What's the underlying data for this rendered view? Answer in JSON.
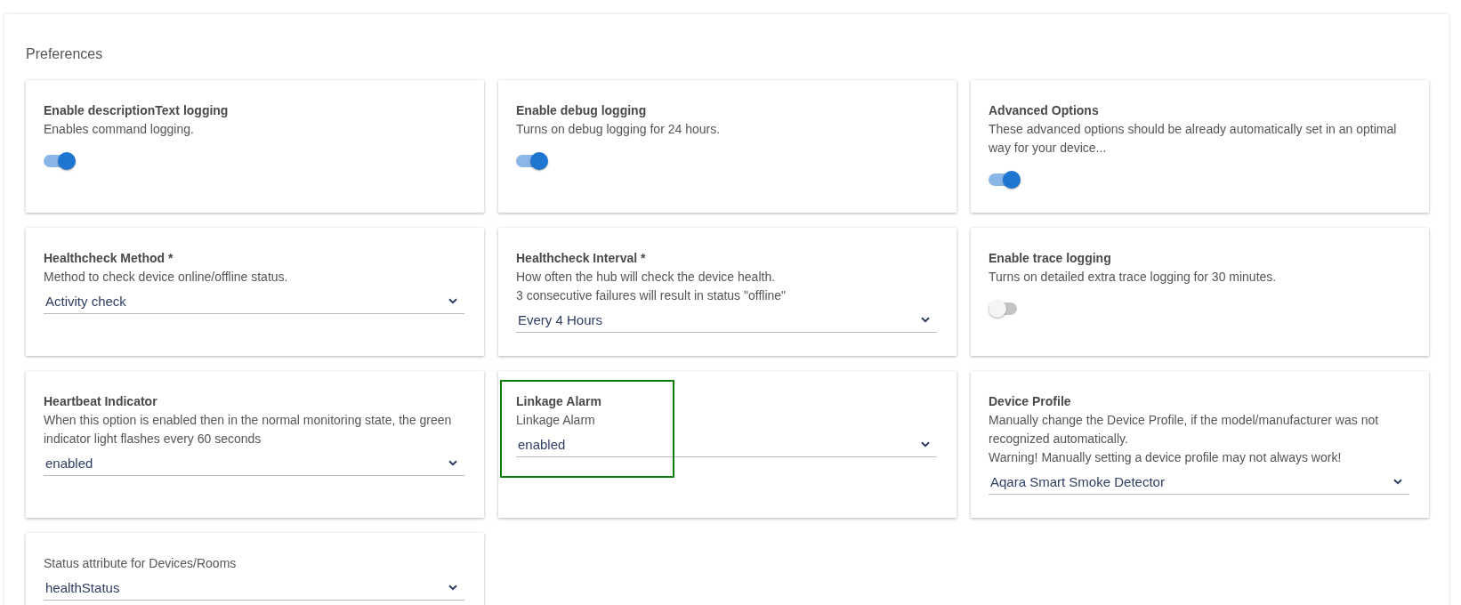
{
  "section_title": "Preferences",
  "cards": [
    {
      "kind": "toggle",
      "title": "Enable descriptionText logging",
      "description": [
        "Enables command logging."
      ],
      "on": true,
      "highlighted": false
    },
    {
      "kind": "toggle",
      "title": "Enable debug logging",
      "description": [
        "Turns on debug logging for 24 hours."
      ],
      "on": true,
      "highlighted": false
    },
    {
      "kind": "toggle",
      "title": "Advanced Options",
      "description": [
        "These advanced options should be already automatically set in an optimal way for your device..."
      ],
      "on": true,
      "highlighted": false
    },
    {
      "kind": "select",
      "title": "Healthcheck Method *",
      "description": [
        "Method to check device online/offline status."
      ],
      "value": "Activity check",
      "highlighted": false
    },
    {
      "kind": "select",
      "title": "Healthcheck Interval *",
      "description": [
        "How often the hub will check the device health.",
        "3 consecutive failures will result in status \"offline\""
      ],
      "value": "Every 4 Hours",
      "highlighted": false
    },
    {
      "kind": "toggle",
      "title": "Enable trace logging",
      "description": [
        "Turns on detailed extra trace logging for 30 minutes."
      ],
      "on": false,
      "highlighted": false
    },
    {
      "kind": "select",
      "title": "Heartbeat Indicator",
      "description": [
        "When this option is enabled then in the normal monitoring state, the green indicator light flashes every 60 seconds"
      ],
      "value": "enabled",
      "highlighted": false
    },
    {
      "kind": "select",
      "title": "Linkage Alarm",
      "description": [
        "Linkage Alarm"
      ],
      "value": "enabled",
      "highlighted": true
    },
    {
      "kind": "select",
      "title": "Device Profile",
      "description": [
        "Manually change the Device Profile, if the model/manufacturer was not recognized automatically.",
        "Warning! Manually setting a device profile may not always work!"
      ],
      "value": "Aqara Smart Smoke Detector",
      "highlighted": false
    },
    {
      "kind": "select",
      "description": [
        "Status attribute for Devices/Rooms"
      ],
      "value": "healthStatus",
      "highlighted": false
    }
  ]
}
